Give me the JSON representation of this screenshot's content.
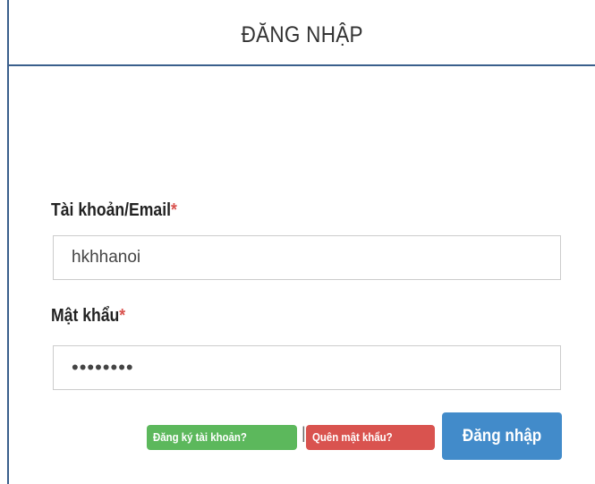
{
  "header": {
    "title": "ĐĂNG NHẬP"
  },
  "form": {
    "username": {
      "label": "Tài khoản/Email",
      "required_mark": "*",
      "value": "hkhhanoi"
    },
    "password": {
      "label": "Mật khẩu",
      "required_mark": "*",
      "value": "••••••••"
    }
  },
  "links": {
    "register": "Đăng ký tài khoản?",
    "separator": "|",
    "forgot_password": "Quên mật khẩu?"
  },
  "actions": {
    "login": "Đăng nhập"
  },
  "colors": {
    "border_accent": "#3a5f8c",
    "register_badge": "#5cb85c",
    "forgot_badge": "#d9534f",
    "login_button": "#428bca",
    "required_mark": "#d9534f"
  }
}
